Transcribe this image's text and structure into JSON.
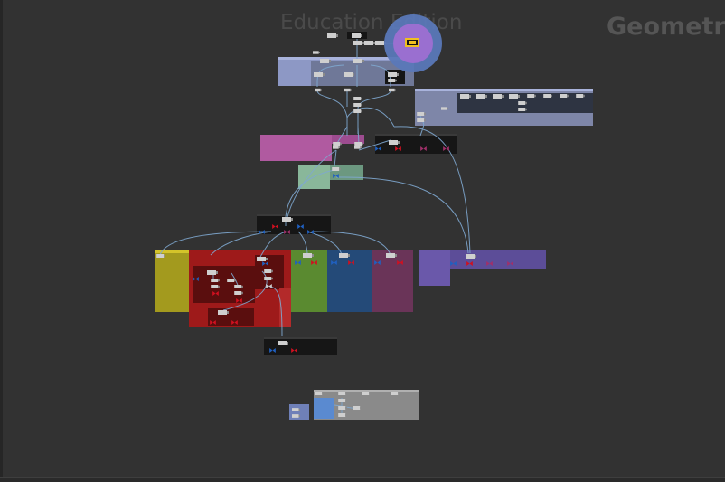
{
  "watermark": "Education Edition",
  "network_context": "Geometry",
  "colors": {
    "background": "#323232",
    "wire": "#7fa8d0",
    "node_body": "#c8c8c8",
    "node_dark": "#151515",
    "flag_display": "#f0c020",
    "input_connector": "#2060c0",
    "output_connector": "#d01020"
  },
  "network_boxes": [
    {
      "id": "box-top-blue",
      "color": "#8d98c5"
    },
    {
      "id": "box-right-blue",
      "color": "#7e86a8"
    },
    {
      "id": "box-magenta",
      "color": "#b05aa0"
    },
    {
      "id": "box-green",
      "color": "#89b79a"
    },
    {
      "id": "box-yellow",
      "color": "#a39a1e"
    },
    {
      "id": "box-red",
      "color": "#9e1a1a"
    },
    {
      "id": "box-olive-green",
      "color": "#5a8a30"
    },
    {
      "id": "box-navy",
      "color": "#244a78"
    },
    {
      "id": "box-plum",
      "color": "#6a3458"
    },
    {
      "id": "box-purple",
      "color": "#6a58aa"
    },
    {
      "id": "box-gray",
      "color": "#8a8a8a"
    },
    {
      "id": "box-small-blue",
      "color": "#6f80b8"
    }
  ]
}
